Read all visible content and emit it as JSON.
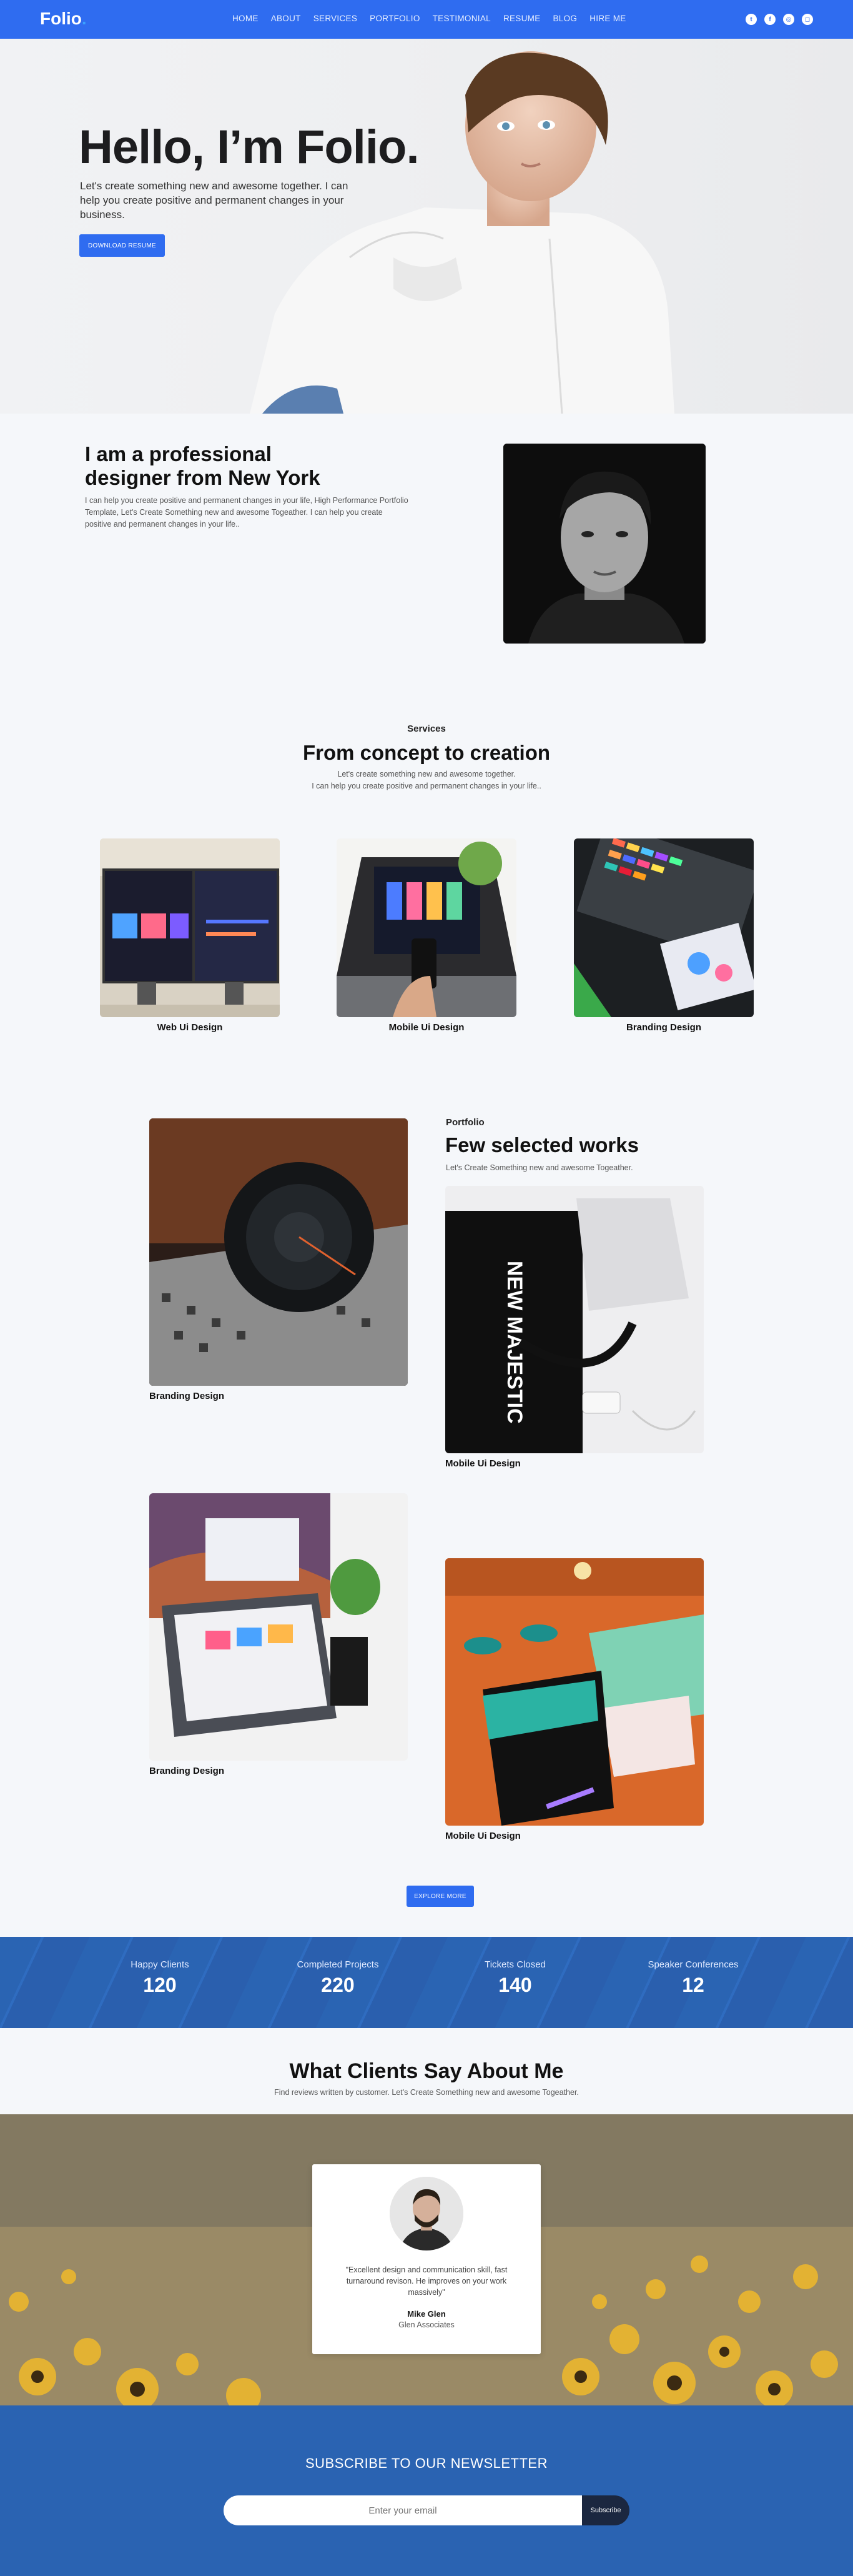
{
  "nav": {
    "logo": "Folio",
    "logo_dot": ".",
    "items": [
      "HOME",
      "ABOUT",
      "SERVICES",
      "PORTFOLIO",
      "TESTIMONIAL",
      "RESUME",
      "BLOG",
      "HIRE ME"
    ],
    "social": [
      "twitter-icon",
      "facebook-icon",
      "dribbble-icon",
      "instagram-icon"
    ]
  },
  "hero": {
    "title": "Hello, I’m Folio.",
    "subtitle": "Let's create something new and awesome together. I can help you create positive and permanent changes in your business.",
    "button": "DOWNLOAD RESUME"
  },
  "about": {
    "title": "I am a professional designer from New York",
    "text": "I can help you create positive and permanent changes in your life, High Performance Portfolio Template, Let's Create Something new and awesome Togeather. I can help you create positive and permanent changes in your life.."
  },
  "services": {
    "eyebrow": "Services",
    "title": "From concept to creation",
    "line1": "Let's create something new and awesome together.",
    "line2": "I can help you create positive and permanent changes in your life..",
    "cards": [
      {
        "label": "Web Ui Design"
      },
      {
        "label": "Mobile Ui Design"
      },
      {
        "label": "Branding Design"
      }
    ]
  },
  "portfolio": {
    "eyebrow": "Portfolio",
    "title": "Few selected works",
    "subtitle": "Let's Create Something new and awesome Togeather.",
    "items": [
      {
        "label": "Branding Design"
      },
      {
        "label": "Mobile Ui Design"
      },
      {
        "label": "Branding Design"
      },
      {
        "label": "Mobile Ui Design"
      }
    ],
    "button": "EXPLORE MORE"
  },
  "stats": [
    {
      "label": "Happy Clients",
      "value": "120"
    },
    {
      "label": "Completed Projects",
      "value": "220"
    },
    {
      "label": "Tickets Closed",
      "value": "140"
    },
    {
      "label": "Speaker Conferences",
      "value": "12"
    }
  ],
  "testimonials": {
    "title": "What Clients Say About Me",
    "subtitle": "Find reviews written by customer. Let's Create Something new and awesome Togeather.",
    "quote": "\"Excellent design and communication skill, fast turnaround revison. He improves on your work massively\"",
    "name": "Mike Glen",
    "company": "Glen Associates"
  },
  "newsletter": {
    "title": "SUBSCRIBE TO OUR NEWSLETTER",
    "placeholder": "Enter your email",
    "button": "Subscribe"
  },
  "colors": {
    "primary": "#2f6cf0",
    "stats_bg": "#2a63b2",
    "page_bg": "#f5f7fa"
  }
}
